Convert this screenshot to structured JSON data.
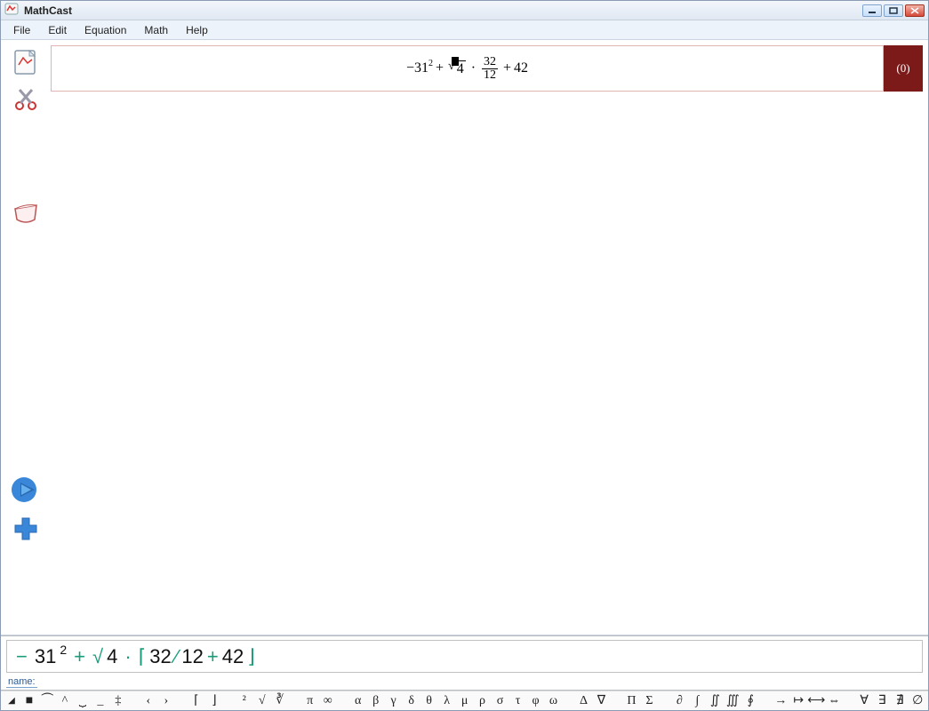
{
  "window": {
    "title": "MathCast"
  },
  "menus": [
    "File",
    "Edit",
    "Equation",
    "Math",
    "Help"
  ],
  "equation": {
    "badge": "(0)",
    "parts": {
      "neg": "−",
      "base": "31",
      "sup": "2",
      "plus1": "+",
      "root_rad": "√",
      "root_arg": "4",
      "dot": "·",
      "frac_num": "32",
      "frac_den": "12",
      "plus2": "+",
      "tail": "42"
    }
  },
  "input": {
    "editor_tokens": [
      {
        "t": "−",
        "c": "g-teal"
      },
      {
        "t": " ",
        "c": ""
      },
      {
        "t": "31",
        "c": ""
      },
      {
        "t": "2",
        "c": "sup2"
      },
      {
        "t": " ",
        "c": ""
      },
      {
        "t": "+",
        "c": "g-teal"
      },
      {
        "t": " ",
        "c": ""
      },
      {
        "t": "√",
        "c": "g-teal"
      },
      {
        "t": "4",
        "c": ""
      },
      {
        "t": " ",
        "c": ""
      },
      {
        "t": "·",
        "c": "g-teal"
      },
      {
        "t": " ",
        "c": ""
      },
      {
        "t": "⌈",
        "c": "g-teal"
      },
      {
        "t": " 32",
        "c": ""
      },
      {
        "t": "∕",
        "c": "g-teal"
      },
      {
        "t": "12 ",
        "c": ""
      },
      {
        "t": "+",
        "c": "g-teal"
      },
      {
        "t": " 42",
        "c": ""
      },
      {
        "t": "⌋",
        "c": "g-teal"
      }
    ],
    "name_label": "name:"
  },
  "symbol_groups": [
    [
      "◢",
      "■",
      "⏜",
      "^",
      "⏟",
      "_",
      "‡"
    ],
    [
      "‹",
      "›"
    ],
    [
      "⌈",
      "⌋"
    ],
    [
      "²",
      "√",
      "∛"
    ],
    [
      "π",
      "∞"
    ],
    [
      "α",
      "β",
      "γ",
      "δ",
      "θ",
      "λ",
      "μ",
      "ρ",
      "σ",
      "τ",
      "φ",
      "ω"
    ],
    [
      "Δ",
      "∇"
    ],
    [
      "Π",
      "Σ"
    ],
    [
      "∂",
      "∫",
      "∬",
      "∭",
      "∮"
    ],
    [
      "→",
      "↦",
      "⟷",
      "⇔"
    ],
    [
      "∀",
      "∃",
      "∄",
      "∅"
    ]
  ]
}
